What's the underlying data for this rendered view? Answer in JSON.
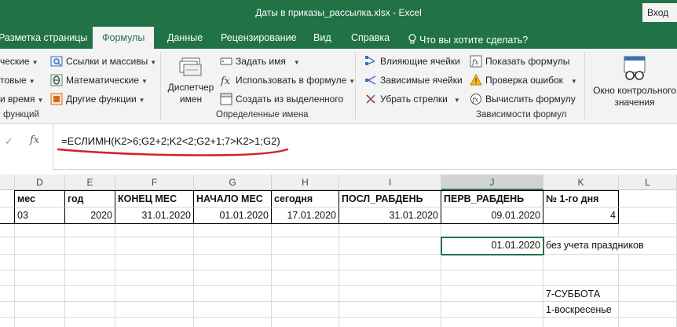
{
  "window": {
    "title": "Даты в приказы_рассылка.xlsx  -  Excel",
    "signin_label": "Вход"
  },
  "tabs": [
    {
      "label": "Разметка страницы"
    },
    {
      "label": "Формулы"
    },
    {
      "label": "Данные"
    },
    {
      "label": "Рецензирование"
    },
    {
      "label": "Вид"
    },
    {
      "label": "Справка"
    },
    {
      "label": "Что вы хотите сделать?"
    }
  ],
  "ribbon": {
    "library": {
      "items": [
        "ческие",
        "товые",
        "и время",
        "Ссылки и массивы",
        "Математические",
        "Другие функции"
      ],
      "group_label": "функций"
    },
    "names": {
      "manager_label_1": "Диспетчер",
      "manager_label_2": "имен",
      "items": [
        "Задать имя",
        "Использовать в формуле",
        "Создать из выделенного"
      ],
      "group_label": "Определенные имена"
    },
    "audit": {
      "items": [
        "Влияющие ячейки",
        "Зависимые ячейки",
        "Убрать стрелки",
        "Показать формулы",
        "Проверка ошибок",
        "Вычислить формулу"
      ],
      "group_label": "Зависимости формул"
    },
    "watch": {
      "label_1": "Окно контрольного",
      "label_2": "значения"
    }
  },
  "formula_bar": {
    "check_glyph": "✓",
    "fx_label": "fx",
    "formula": "=ЕСЛИМН(K2>6;G2+2;K2<2;G2+1;7>K2>1;G2)"
  },
  "columns": [
    "D",
    "E",
    "F",
    "G",
    "H",
    "I",
    "J",
    "K",
    "L"
  ],
  "rows": {
    "header": [
      "мес",
      "год",
      "КОНЕЦ МЕС",
      "НАЧАЛО МЕС",
      "сегодня",
      "ПОСЛ_РАБДЕНЬ",
      "ПЕРВ_РАБДЕНЬ",
      "№ 1-го дня"
    ],
    "values": [
      "03",
      "2020",
      "31.01.2020",
      "01.01.2020",
      "17.01.2020",
      "31.01.2020",
      "09.01.2020",
      "4"
    ],
    "note_row": {
      "j_value": "01.01.2020",
      "k_text": "без учета праздников"
    },
    "legend_1": "7-СУББОТА",
    "legend_2": "1-воскресенье"
  },
  "accent_colors": {
    "excel_green": "#217346",
    "annotation_red": "#d42027"
  }
}
